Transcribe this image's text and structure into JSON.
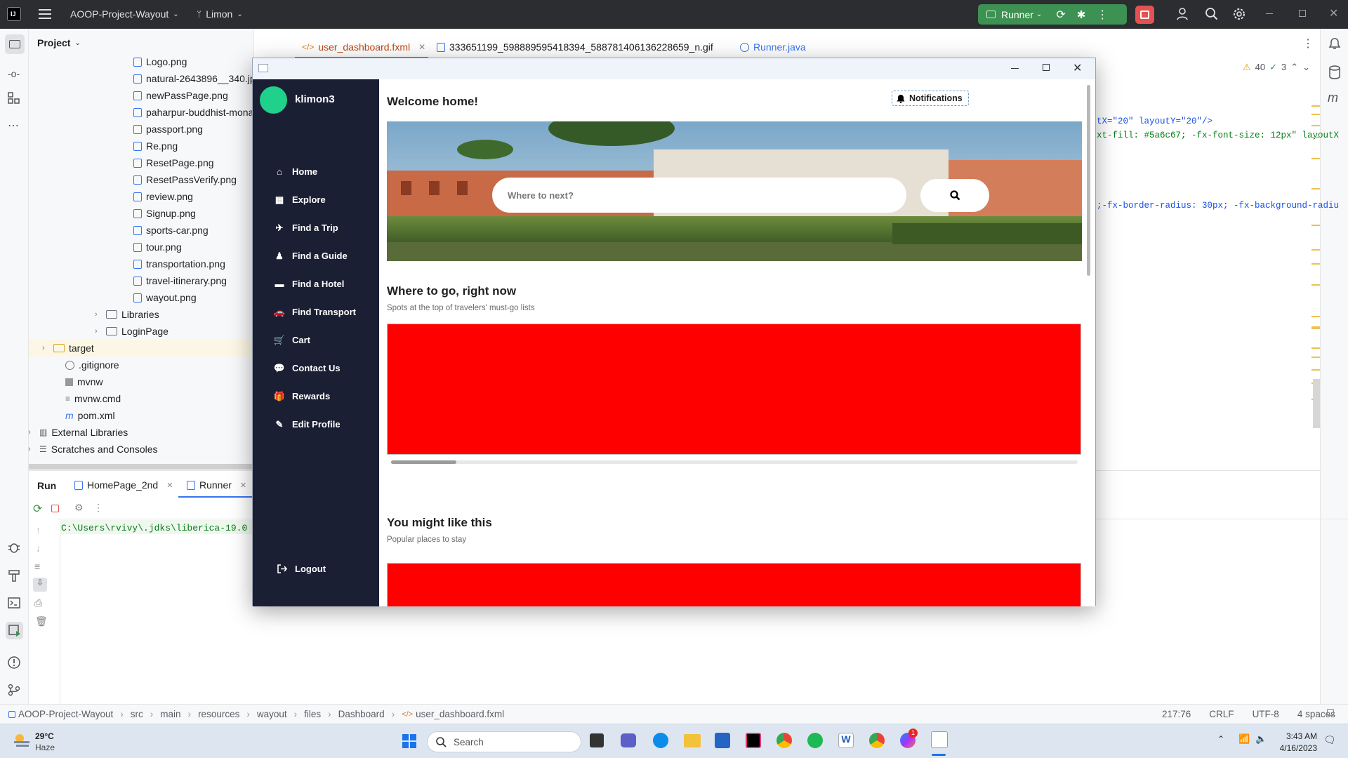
{
  "ide": {
    "project_name": "AOOP-Project-Wayout",
    "branch": "Limon",
    "run_config": "Runner",
    "project_panel_title": "Project",
    "tabs": [
      {
        "label": "user_dashboard.fxml",
        "active": true
      },
      {
        "label": "333651199_598889595418394_588781406136228659_n.gif",
        "active": false
      },
      {
        "label": "Runner.java",
        "active": false
      }
    ],
    "inspections": {
      "warnings": "40",
      "weak_warnings": "3"
    },
    "code_lines": [
      "tX=\"20\" layoutY=\"20\"/>",
      "xt-fill: #5a6c67; -fx-font-size: 12px\" layoutX",
      ";-fx-border-radius: 30px; -fx-background-radiu"
    ],
    "tree": [
      "Logo.png",
      "natural-2643896__340.jp",
      "newPassPage.png",
      "paharpur-buddhist-mona",
      "passport.png",
      "Re.png",
      "ResetPage.png",
      "ResetPassVerify.png",
      "review.png",
      "Signup.png",
      "sports-car.png",
      "tour.png",
      "transportation.png",
      "travel-itinerary.png",
      "wayout.png"
    ],
    "tree_folders": [
      "Libraries",
      "LoginPage",
      "target"
    ],
    "tree_files": [
      ".gitignore",
      "mvnw",
      "mvnw.cmd",
      "pom.xml"
    ],
    "tree_bottom": [
      "External Libraries",
      "Scratches and Consoles"
    ],
    "run": {
      "label": "Run",
      "tabs": [
        "HomePage_2nd",
        "Runner"
      ],
      "console_line": "C:\\Users\\rvivy\\.jdks\\liberica-19.0"
    },
    "breadcrumb": [
      "AOOP-Project-Wayout",
      "src",
      "main",
      "resources",
      "wayout",
      "files",
      "Dashboard",
      "user_dashboard.fxml"
    ],
    "status_right": {
      "position": "217:76",
      "line_sep": "CRLF",
      "encoding": "UTF-8",
      "indent": "4 spaces"
    }
  },
  "app": {
    "username": "klimon3",
    "nav": [
      "Home",
      "Explore",
      "Find a Trip",
      "Find a Guide",
      "Find a Hotel",
      "Find Transport",
      "Cart",
      "Contact Us",
      "Rewards",
      "Edit Profile"
    ],
    "logout": "Logout",
    "welcome": "Welcome home!",
    "notifications": "Notifications",
    "search_placeholder": "Where to next?",
    "section1_title": "Where to go, right now",
    "section1_sub": "Spots at the top of travelers' must-go lists",
    "section2_title": "You might like this",
    "section2_sub": "Popular places to stay",
    "avatar_color": "#1fd18a",
    "sidebar_color": "#1b1f34",
    "placeholder_color": "#ff0000"
  },
  "taskbar": {
    "weather_temp": "29°C",
    "weather_desc": "Haze",
    "search": "Search",
    "time": "3:43 AM",
    "date": "4/16/2023",
    "messenger_badge": "1"
  }
}
